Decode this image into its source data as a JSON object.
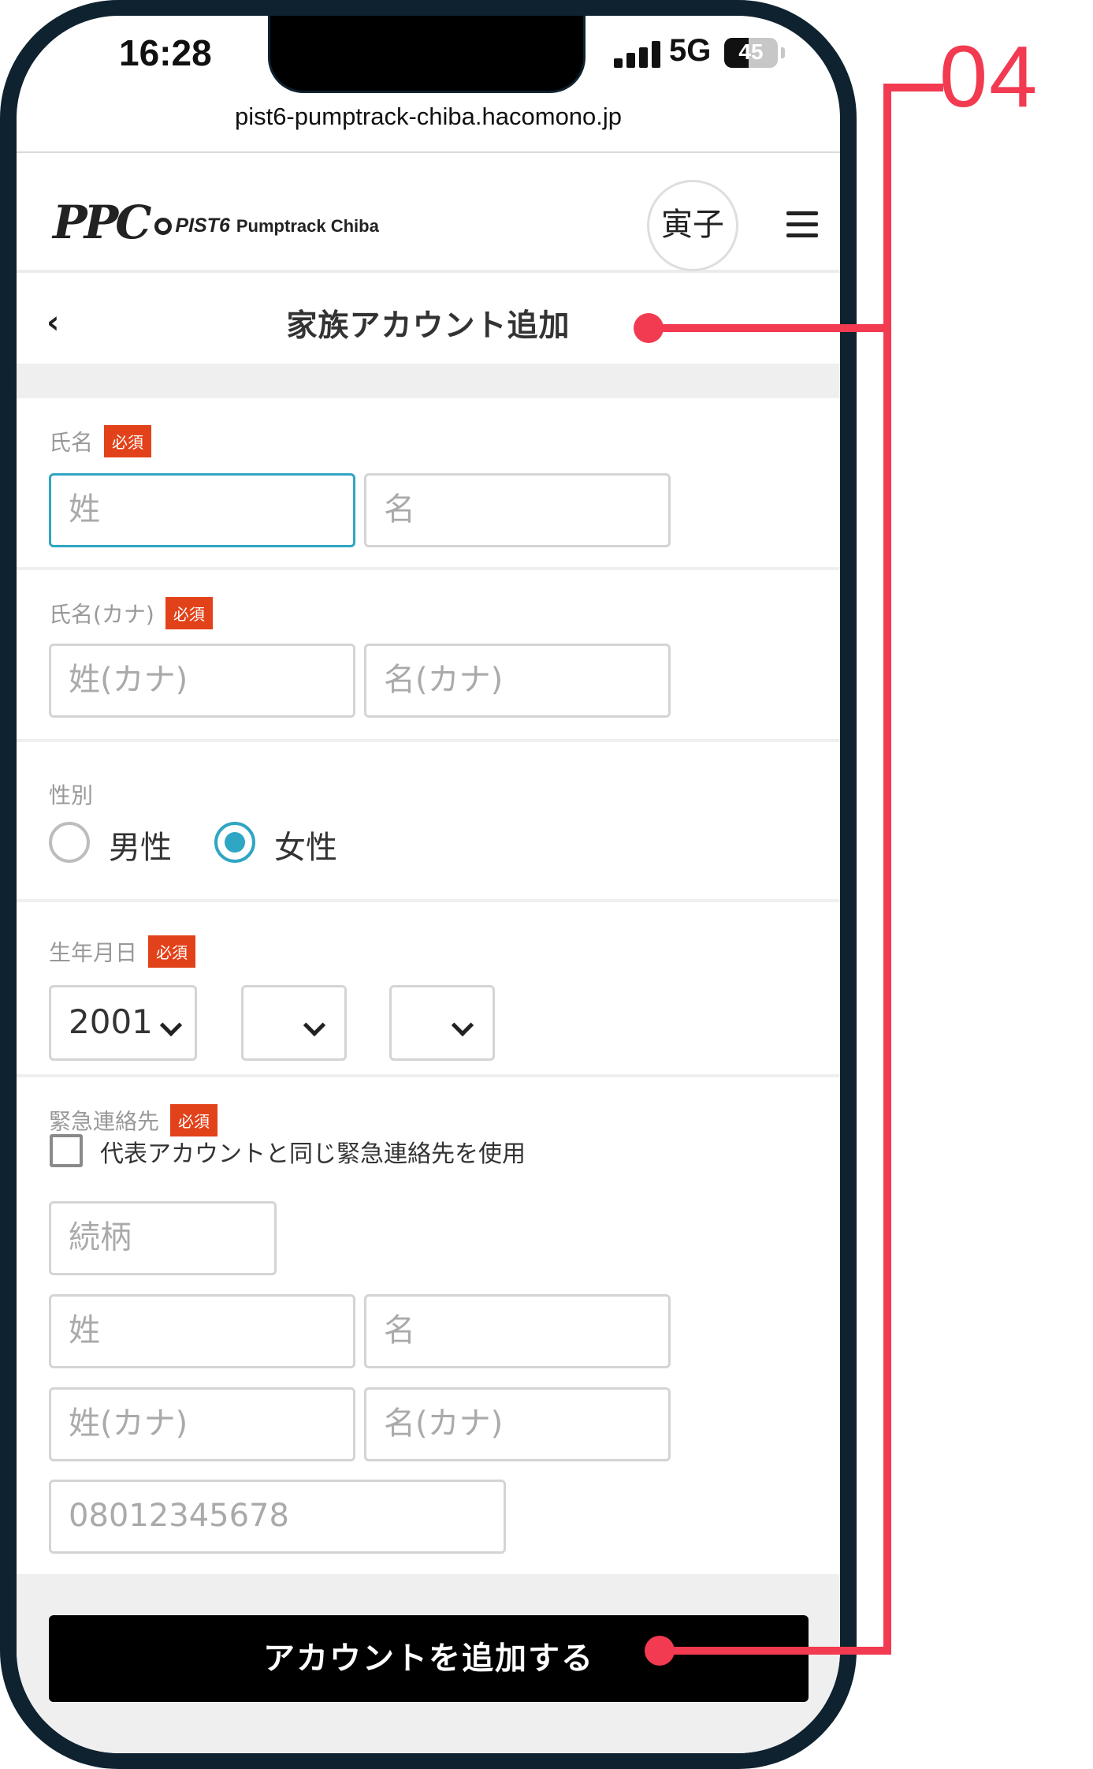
{
  "status_bar": {
    "time": "16:28",
    "network": "5G",
    "battery": "45",
    "battery_level": 0.45
  },
  "browser": {
    "url": "pist6-pumptrack-chiba.hacomono.jp"
  },
  "header": {
    "logo_mark": "PPC",
    "logo_text": "PIST6",
    "logo_sub": "Pumptrack Chiba",
    "avatar_label": "寅子"
  },
  "page": {
    "title": "家族アカウント追加"
  },
  "required_badge": "必須",
  "name": {
    "label": "氏名",
    "last_placeholder": "姓",
    "first_placeholder": "名"
  },
  "kana": {
    "label": "氏名(カナ)",
    "last_placeholder": "姓(カナ)",
    "first_placeholder": "名(カナ)"
  },
  "gender": {
    "label": "性別",
    "options": [
      {
        "label": "男性",
        "selected": false
      },
      {
        "label": "女性",
        "selected": true
      }
    ]
  },
  "birthdate": {
    "label": "生年月日",
    "year": "2001",
    "month": "",
    "day": ""
  },
  "emergency": {
    "label": "緊急連絡先",
    "checkbox_label": "代表アカウントと同じ緊急連絡先を使用",
    "relation_placeholder": "続柄",
    "last_placeholder": "姓",
    "first_placeholder": "名",
    "last_kana_placeholder": "姓(カナ)",
    "first_kana_placeholder": "名(カナ)",
    "phone_placeholder": "08012345678"
  },
  "submit_label": "アカウントを追加する",
  "callout": {
    "number": "04",
    "color": "#f23a50"
  },
  "colors": {
    "accent": "#2fa6c3",
    "required": "#e2421a",
    "button": "#000000"
  }
}
